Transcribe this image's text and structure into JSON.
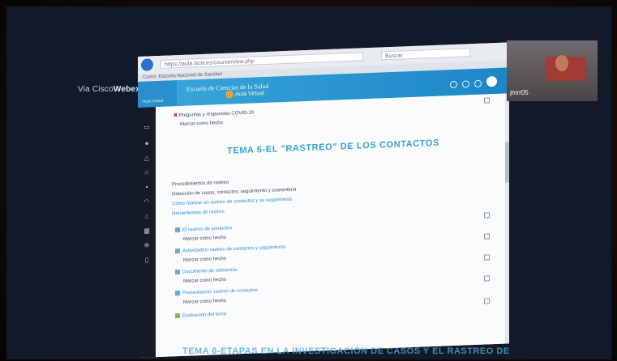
{
  "webex": {
    "prefix": "Via Cisco",
    "brand": "Webex"
  },
  "browser": {
    "url": "https://aula.isciii.es/course/view.php",
    "search_placeholder": "Buscar",
    "tab_title": "Curso: Escuela Nacional de Sanidad"
  },
  "site": {
    "title": "Escuela de Ciencias de la Salud",
    "subtitle": "Aula Virtual",
    "left_label": "Aula Virtual"
  },
  "sidebar": {
    "icons": [
      "dashboard-icon",
      "user-icon",
      "bell-icon",
      "star-icon",
      "calendar-icon",
      "folder-icon",
      "home-icon",
      "grid-icon",
      "settings-icon",
      "book-icon"
    ]
  },
  "content": {
    "top_item": "Preguntas y respuestas COVID-19",
    "top_status": "Marcar como hecho",
    "section_title": "TEMA 5-EL \"RASTREO\" DE LOS CONTACTOS",
    "intro_lines": [
      "Procedimientos de rastreo",
      "Detección de casos, contactos, seguimiento y cuarentena",
      "Cómo realizar un rastreo de contactos y su seguimiento",
      "Herramientas de rastreo"
    ],
    "activities": [
      {
        "title": "El rastreo de contactos",
        "status": "Marcar como hecho"
      },
      {
        "title": "Actividades: rastreo de contactos y seguimiento",
        "status": "Marcar como hecho"
      },
      {
        "title": "Documento de referencia",
        "status": "Marcar como hecho"
      },
      {
        "title": "Presentación: rastreo de contactos",
        "status": "Marcar como hecho"
      },
      {
        "title": "Evaluación del tema",
        "status": ""
      }
    ],
    "next_section_title": "TEMA 6-ETAPAS EN LA INVESTIGACIÓN DE CASOS Y EL RASTREO DE"
  },
  "camera": {
    "participant": "jmrr05"
  },
  "colors": {
    "accent": "#2c8ccf",
    "header": "#1c86c7",
    "heading": "#39a0cf"
  }
}
